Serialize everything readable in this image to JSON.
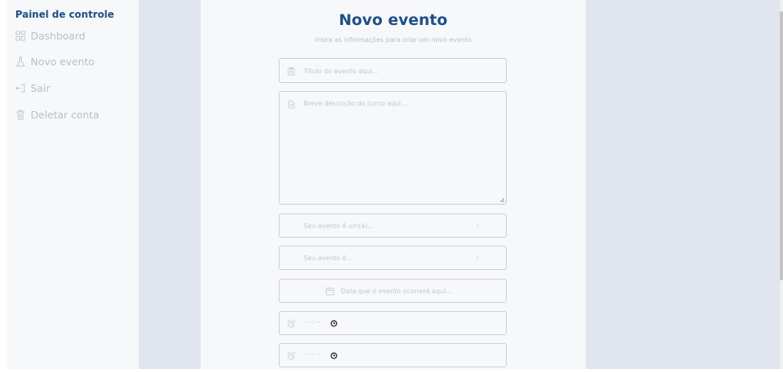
{
  "sidebar": {
    "title": "Painel de controle",
    "items": [
      {
        "label": "Dashboard",
        "icon": "dashboard-grid-icon"
      },
      {
        "label": "Novo evento",
        "icon": "flask-icon"
      },
      {
        "label": "Sair",
        "icon": "logout-icon"
      },
      {
        "label": "Deletar conta",
        "icon": "trash-icon"
      }
    ]
  },
  "form": {
    "title": "Novo evento",
    "subtitle": "Insira as informações para criar um novo evento",
    "title_placeholder": "Título do evento aqui...",
    "description_placeholder": "Breve descrição do curso aqui...",
    "type_placeholder": "Seu evento é um(a)...",
    "mode_placeholder": "Seu evento é...",
    "date_placeholder": "Data que o evento ocorrerá aqui...",
    "start_time_value": "--:--",
    "end_time_value": "--:--"
  },
  "colors": {
    "brand": "#1f4f86",
    "muted_text": "#b8bec8",
    "band": "#e1e6ee",
    "panel": "#f7f8fa"
  }
}
